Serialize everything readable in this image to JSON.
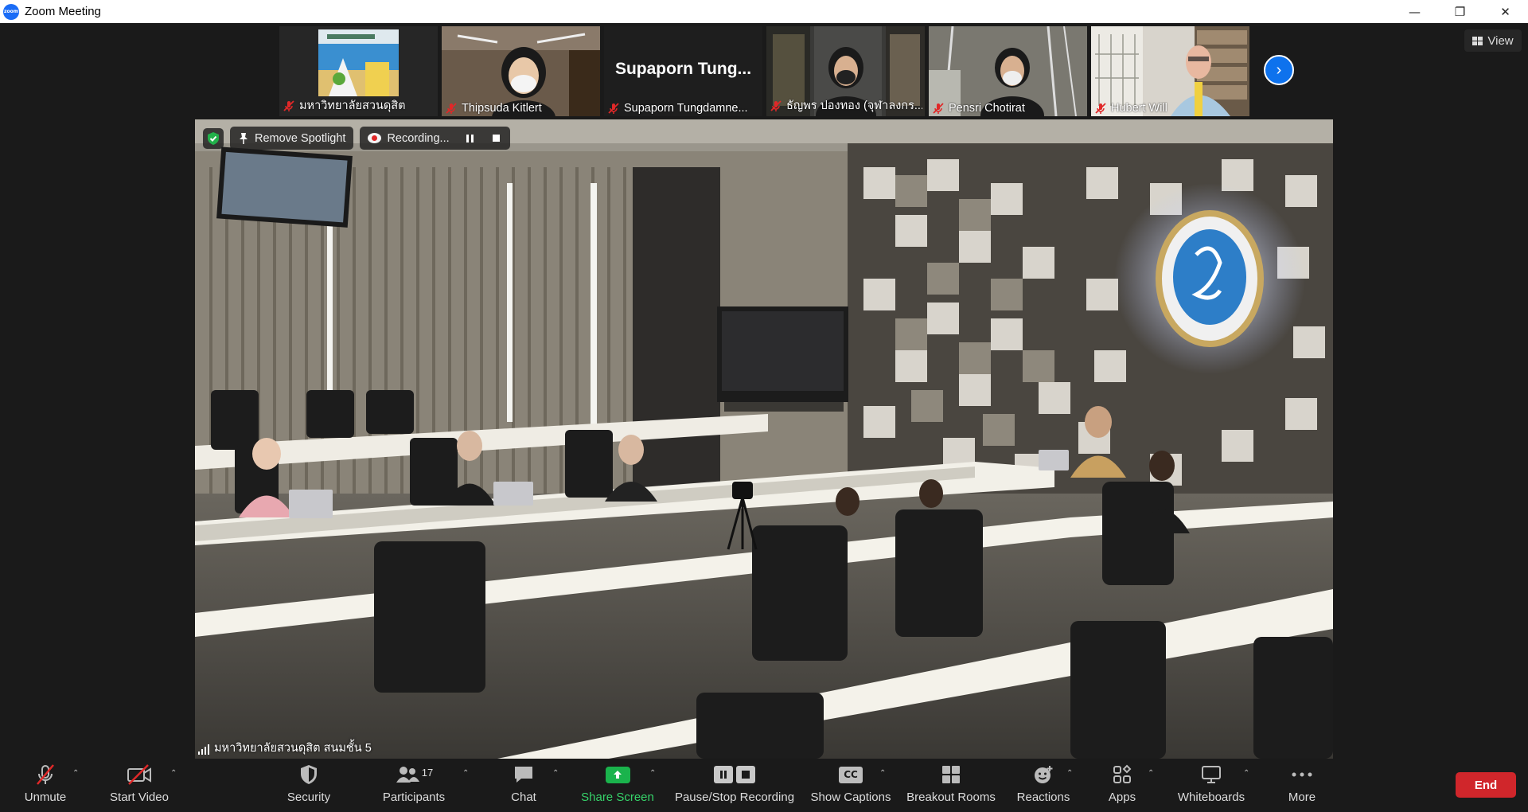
{
  "window": {
    "title": "Zoom Meeting",
    "minimize": "—",
    "restore": "❐",
    "close": "✕"
  },
  "thumbnails": [
    {
      "name": "มหาวิทยาลัยสวนดุสิต",
      "muted": true,
      "video": "image"
    },
    {
      "name": "Thipsuda Kitlert",
      "muted": true,
      "video": "camera"
    },
    {
      "name": "Supaporn Tungdamne...",
      "display": "Supaporn Tung...",
      "muted": true,
      "video": "off"
    },
    {
      "name": "ธัญพร ปองทอง (จุฬาลงกร...",
      "muted": true,
      "video": "camera"
    },
    {
      "name": "Pensri Chotirat",
      "muted": true,
      "video": "camera"
    },
    {
      "name": "Hubert Will",
      "muted": true,
      "video": "camera"
    }
  ],
  "view_button": {
    "label": "View"
  },
  "main_video": {
    "remove_spotlight": "Remove Spotlight",
    "recording": "Recording...",
    "speaker_name": "มหาวิทยาลัยสวนดุสิต สนมชั้น 5"
  },
  "toolbar": {
    "unmute": "Unmute",
    "start_video": "Start Video",
    "security": "Security",
    "participants": "Participants",
    "participants_count": "17",
    "chat": "Chat",
    "share_screen": "Share Screen",
    "pause_stop_recording": "Pause/Stop Recording",
    "show_captions": "Show Captions",
    "cc": "CC",
    "breakout_rooms": "Breakout Rooms",
    "reactions": "Reactions",
    "apps": "Apps",
    "whiteboards": "Whiteboards",
    "more": "More",
    "end": "End"
  },
  "colors": {
    "accent_blue": "#0e72ed",
    "share_green": "#1ab34c",
    "end_red": "#d0262b",
    "mute_red": "#e02828",
    "background": "#1a1a1a"
  }
}
